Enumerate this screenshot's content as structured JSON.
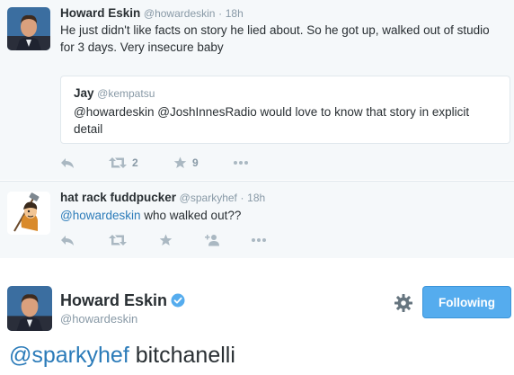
{
  "tweet1": {
    "name": "Howard Eskin",
    "handle": "@howardeskin",
    "sep": "·",
    "time": "18h",
    "text": "He just didn't like facts on story he lied about. So he got up, walked out of studio for 3 days. Very insecure baby",
    "quoted": {
      "name": "Jay",
      "handle": "@kempatsu",
      "text": "@howardeskin @JoshInnesRadio would love to know that story in explicit detail"
    },
    "retweet_count": "2",
    "favorite_count": "9",
    "icons": [
      "reply-icon",
      "retweet-icon",
      "star-icon",
      "more-icon"
    ]
  },
  "tweet2": {
    "name": "hat rack fuddpucker",
    "handle": "@sparkyhef",
    "sep": "·",
    "time": "18h",
    "mention": "@howardeskin",
    "text": "who walked out??",
    "icons": [
      "reply-icon",
      "retweet-icon",
      "star-icon",
      "follow-icon",
      "more-icon"
    ]
  },
  "tweet3": {
    "name": "Howard Eskin",
    "handle": "@howardeskin",
    "follow_label": "Following",
    "mention": "@sparkyhef",
    "text": "bitchanelli",
    "icons": [
      "verified-icon",
      "gear-icon"
    ]
  },
  "colors": {
    "link": "#2b7bb9",
    "follow_button": "#55acee",
    "muted": "#8899a6",
    "icon": "#aab8c2",
    "background_tweet": "#f5f8fa"
  }
}
